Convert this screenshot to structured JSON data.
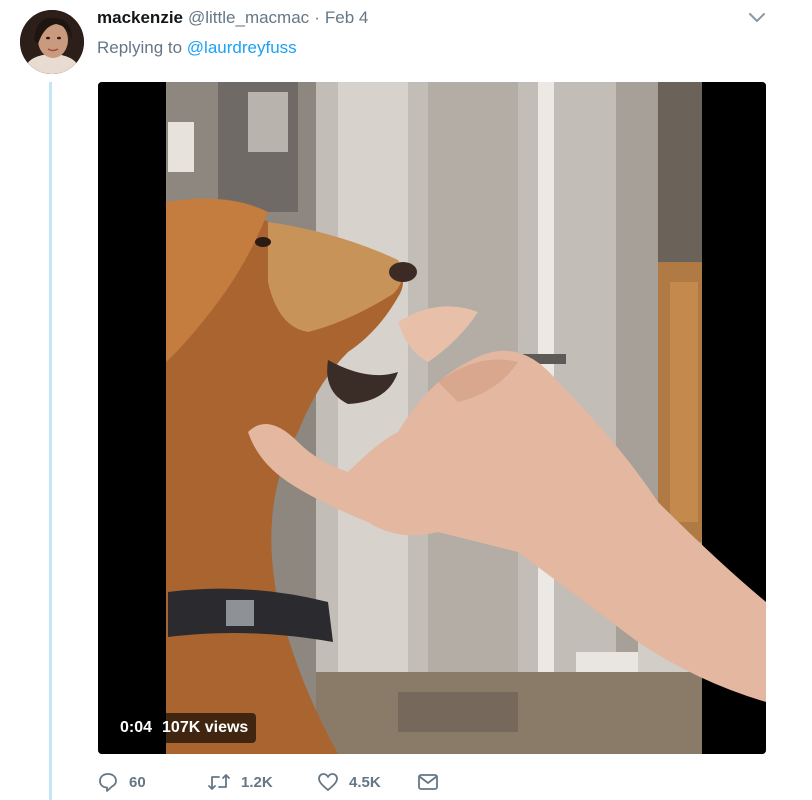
{
  "tweet": {
    "name": "mackenzie",
    "handle": "@little_macmac",
    "separator": "·",
    "date": "Feb 4",
    "reply_prefix": "Replying to",
    "reply_to": "@laurdreyfuss"
  },
  "video": {
    "time": "0:04",
    "views": "107K views"
  },
  "actions": {
    "replies": "60",
    "retweets": "1.2K",
    "likes": "4.5K"
  },
  "icons": {
    "caret": "chevron-down-icon",
    "reply": "reply-icon",
    "retweet": "retweet-icon",
    "like": "heart-icon",
    "dm": "envelope-icon"
  },
  "colors": {
    "link": "#1da1f2",
    "muted": "#657786",
    "thread_line": "#c4e4f7"
  }
}
